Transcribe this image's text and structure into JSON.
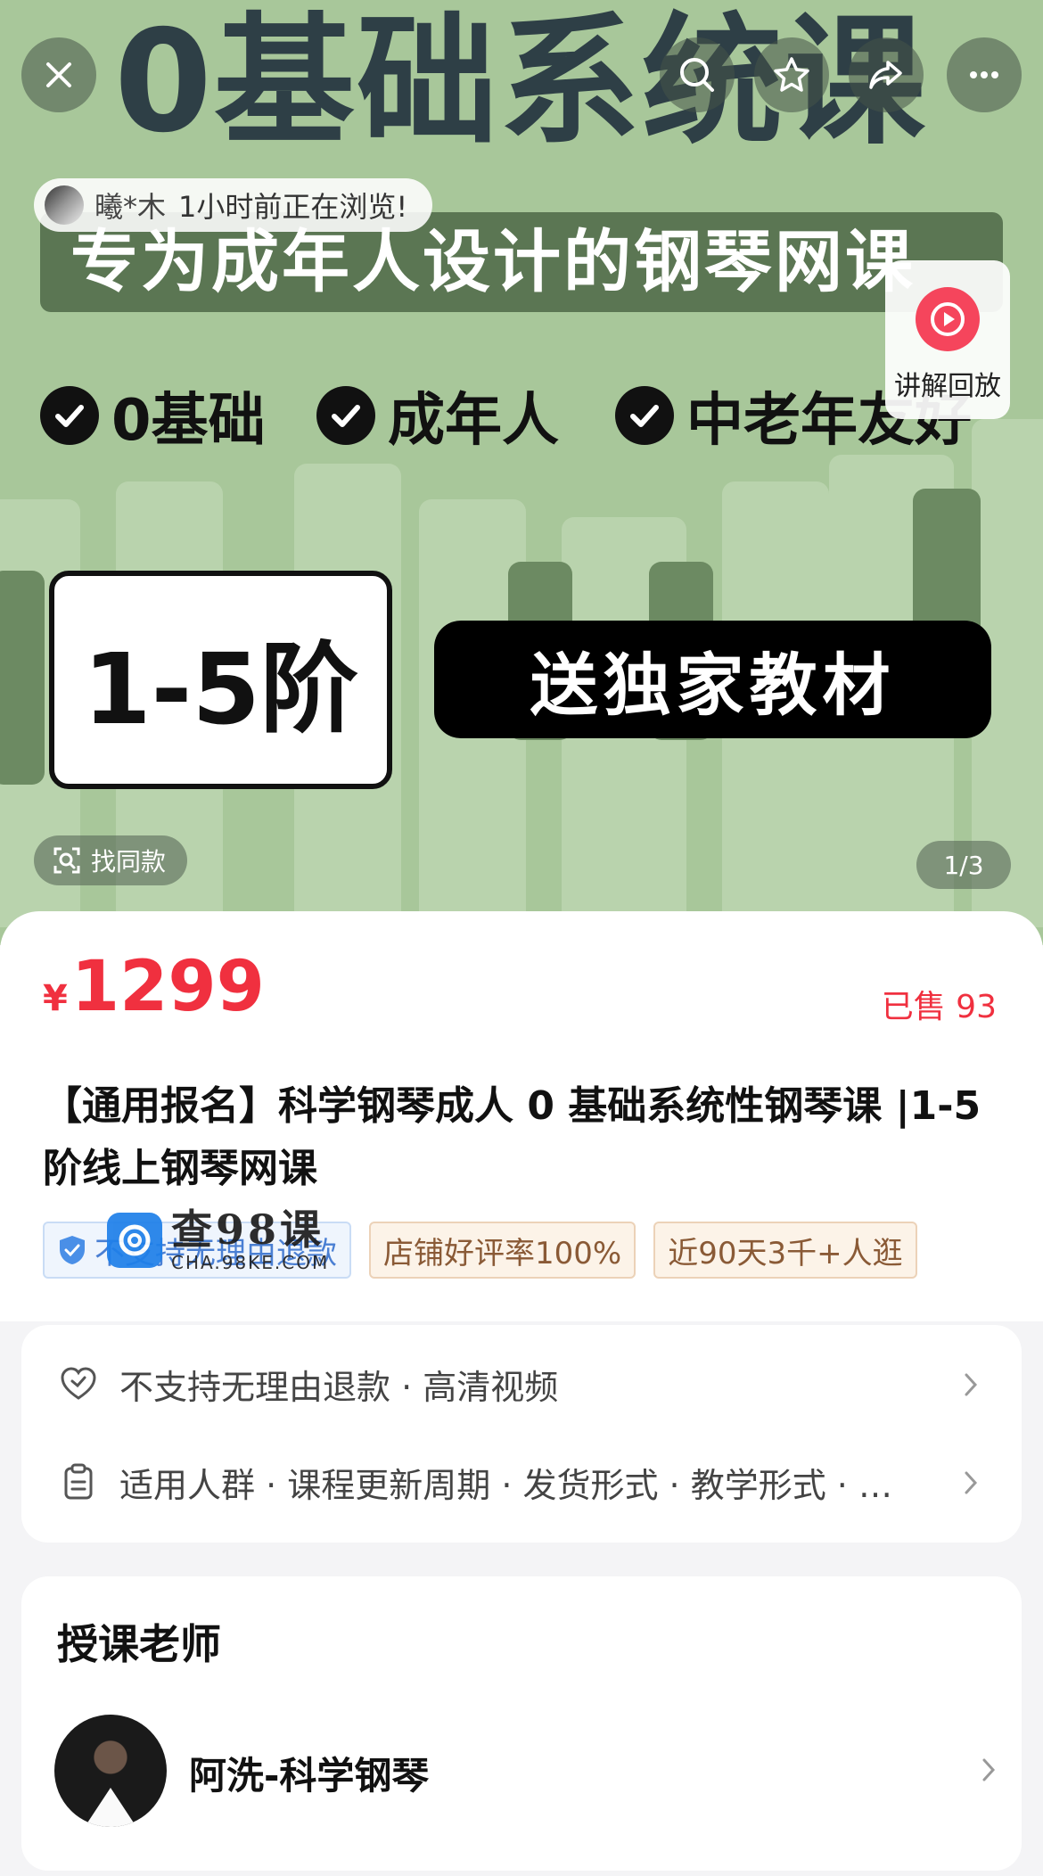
{
  "hero": {
    "title": "0基础系统课",
    "subtitle": "专为成年人设计的钢琴网课",
    "checks": [
      "0基础",
      "成年人",
      "中老年友好"
    ],
    "level": "1-5阶",
    "gift": "送独家教材",
    "viewer": {
      "name": "曦*木",
      "text": "1小时前正在浏览!"
    },
    "replay_label": "讲解回放",
    "find_label": "找同款",
    "page_indicator": "1/3"
  },
  "product": {
    "currency": "¥",
    "price": "1299",
    "sold": "已售 93",
    "title": "【通用报名】科学钢琴成人 0 基础系统性钢琴课 |1-5 阶线上钢琴网课",
    "tags": [
      "不支持无理由退款",
      "店铺好评率100%",
      "近90天3千+人逛"
    ]
  },
  "watermark": {
    "main": "查98课",
    "sub": "CHA.98KE.COM"
  },
  "services": {
    "row1": "不支持无理由退款 · 高清视频",
    "row2": "适用人群 · 课程更新周期 · 发货形式 · 教学形式 · …"
  },
  "teacher": {
    "section_title": "授课老师",
    "name": "阿洗-科学钢琴"
  },
  "colors": {
    "accent": "#f0303f",
    "hero_bg": "#a8c79a",
    "subtitle_bg": "#5b7653"
  }
}
